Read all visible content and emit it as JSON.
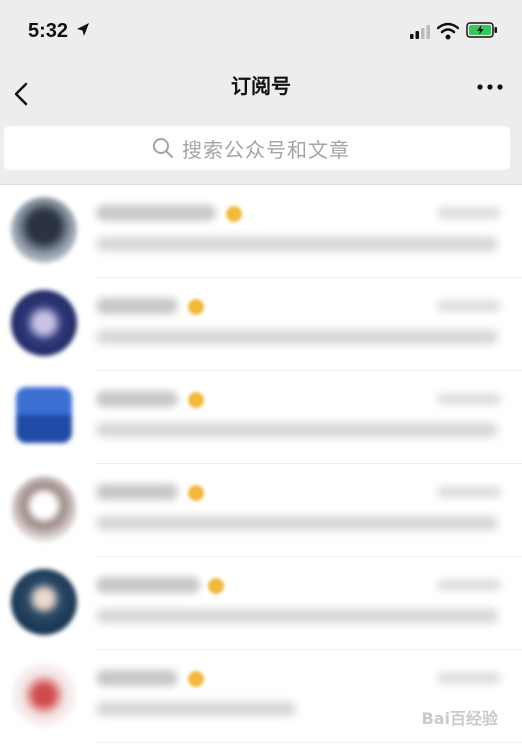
{
  "status_bar": {
    "time": "5:32",
    "battery_color": "#34c759"
  },
  "header": {
    "title": "订阅号"
  },
  "search": {
    "placeholder": "搜索公众号和文章"
  },
  "list": {
    "items": [
      {
        "avatar_color": "#5a6675"
      },
      {
        "avatar_color": "#2f3a7a"
      },
      {
        "avatar_color": "#2a56b8"
      },
      {
        "avatar_color": "#9b8a86"
      },
      {
        "avatar_color": "#1f4b6e"
      },
      {
        "avatar_color": "#d14a4a"
      }
    ]
  },
  "watermark": {
    "text": "Bai百经验"
  },
  "colors": {
    "verified_badge": "#f2b93b",
    "bar_background": "#ededed"
  }
}
